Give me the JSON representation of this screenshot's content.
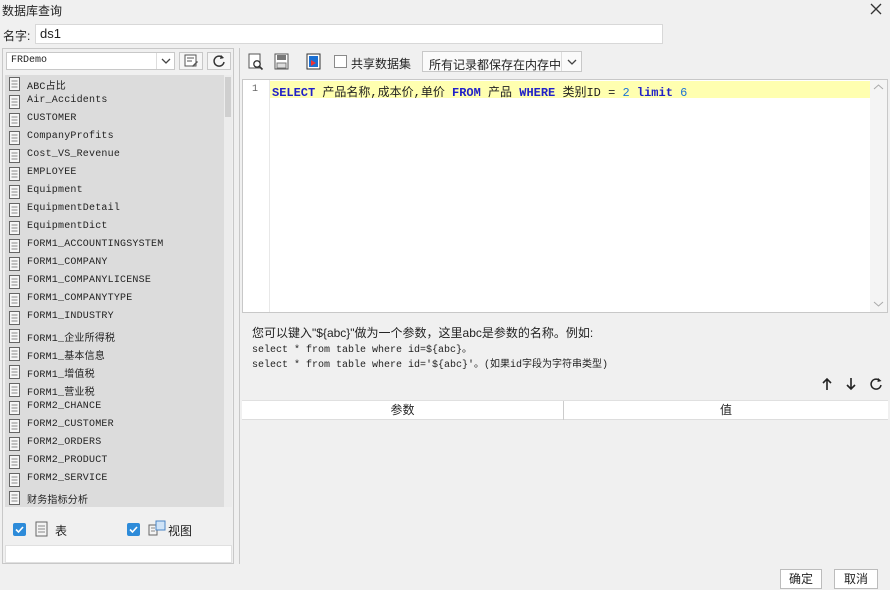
{
  "window": {
    "title": "数据库查询"
  },
  "name": {
    "label": "名字:",
    "value": "ds1"
  },
  "db_select": {
    "value": "FRDemo"
  },
  "tables": [
    "ABC占比",
    "Air_Accidents",
    "CUSTOMER",
    "CompanyProfits",
    "Cost_VS_Revenue",
    "EMPLOYEE",
    "Equipment",
    "EquipmentDetail",
    "EquipmentDict",
    "FORM1_ACCOUNTINGSYSTEM",
    "FORM1_COMPANY",
    "FORM1_COMPANYLICENSE",
    "FORM1_COMPANYTYPE",
    "FORM1_INDUSTRY",
    "FORM1_企业所得税",
    "FORM1_基本信息",
    "FORM1_增值税",
    "FORM1_营业税",
    "FORM2_CHANCE",
    "FORM2_CUSTOMER",
    "FORM2_ORDERS",
    "FORM2_PRODUCT",
    "FORM2_SERVICE",
    "财务指标分析"
  ],
  "filters": {
    "table_label": "表",
    "view_label": "视图"
  },
  "toolbar": {
    "share_label": "共享数据集",
    "cache_value": "所有记录都保存在内存中"
  },
  "editor": {
    "line_number": "1",
    "tokens": {
      "select": "SELECT",
      "fields": " 产品名称,成本价,单价 ",
      "from": "FROM",
      "table": " 产品 ",
      "where": "WHERE",
      "cond": " 类别ID = ",
      "val": "2",
      "limit": " limit ",
      "lim": "6"
    }
  },
  "hint": {
    "line1": "您可以键入\"${abc}\"做为一个参数，这里abc是参数的名称。例如:",
    "line2": "select * from table where id=${abc}。",
    "line3": "select * from table where id='${abc}'。(如果id字段为字符串类型)"
  },
  "params_table": {
    "col_param": "参数",
    "col_value": "值"
  },
  "buttons": {
    "ok": "确定",
    "cancel": "取消"
  }
}
